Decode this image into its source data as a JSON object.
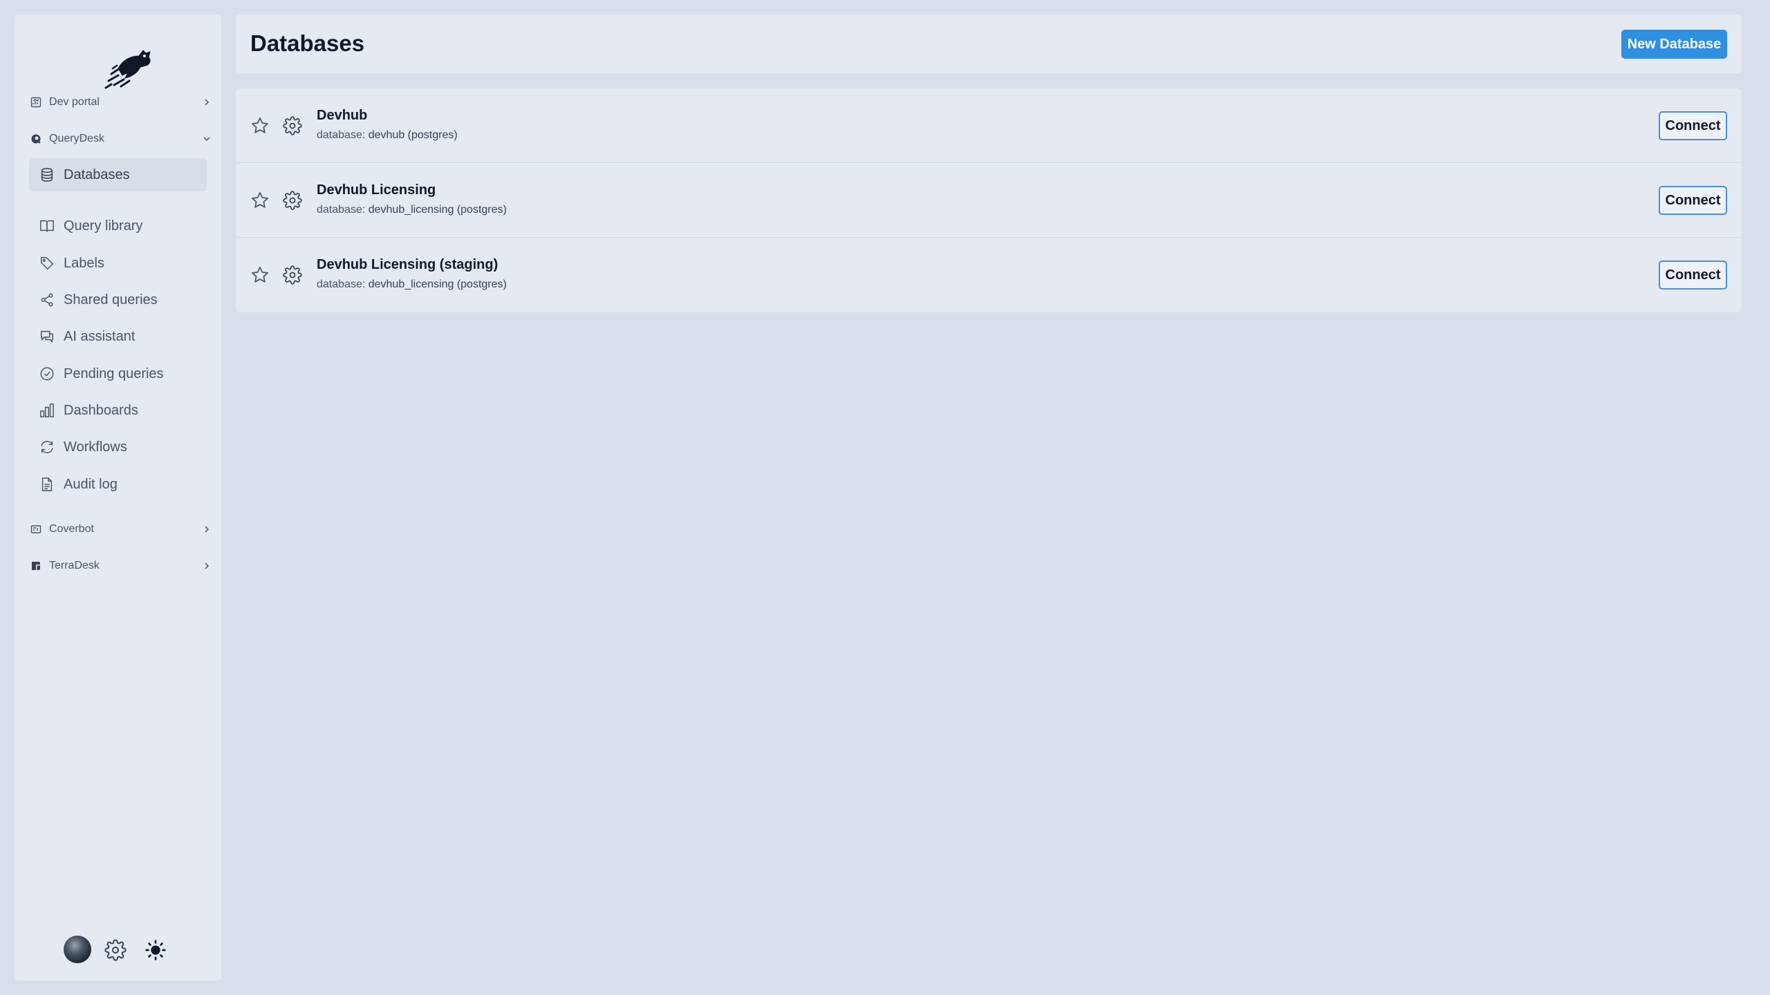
{
  "sidebar": {
    "sections": [
      {
        "label": "Dev portal",
        "icon": "chart-square-icon",
        "expanded": false
      },
      {
        "label": "QueryDesk",
        "icon": "querydesk-logo-icon",
        "expanded": true
      },
      {
        "label": "Coverbot",
        "icon": "coverbot-icon",
        "expanded": false
      },
      {
        "label": "TerraDesk",
        "icon": "terradesk-icon",
        "expanded": false
      }
    ],
    "items": [
      {
        "label": "Databases",
        "icon": "database-icon",
        "active": true
      },
      {
        "label": "Query library",
        "icon": "book-icon"
      },
      {
        "label": "Labels",
        "icon": "tag-icon"
      },
      {
        "label": "Shared queries",
        "icon": "share-icon"
      },
      {
        "label": "AI assistant",
        "icon": "chat-icon"
      },
      {
        "label": "Pending queries",
        "icon": "check-circle-icon"
      },
      {
        "label": "Dashboards",
        "icon": "bar-chart-icon"
      },
      {
        "label": "Workflows",
        "icon": "refresh-icon"
      },
      {
        "label": "Audit log",
        "icon": "document-icon"
      }
    ]
  },
  "header": {
    "title": "Databases",
    "new_button": "New Database"
  },
  "databases": [
    {
      "name": "Devhub",
      "desc_prefix": "database:",
      "desc_value": "devhub (postgres)",
      "connect": "Connect"
    },
    {
      "name": "Devhub Licensing",
      "desc_prefix": "database:",
      "desc_value": "devhub_licensing (postgres)",
      "connect": "Connect"
    },
    {
      "name": "Devhub Licensing (staging)",
      "desc_prefix": "database:",
      "desc_value": "devhub_licensing (postgres)",
      "connect": "Connect"
    }
  ],
  "colors": {
    "background": "#d9dfea",
    "panel": "#e4e9f2",
    "primary": "#2f8fe0",
    "connect_border": "#4a90d0"
  }
}
